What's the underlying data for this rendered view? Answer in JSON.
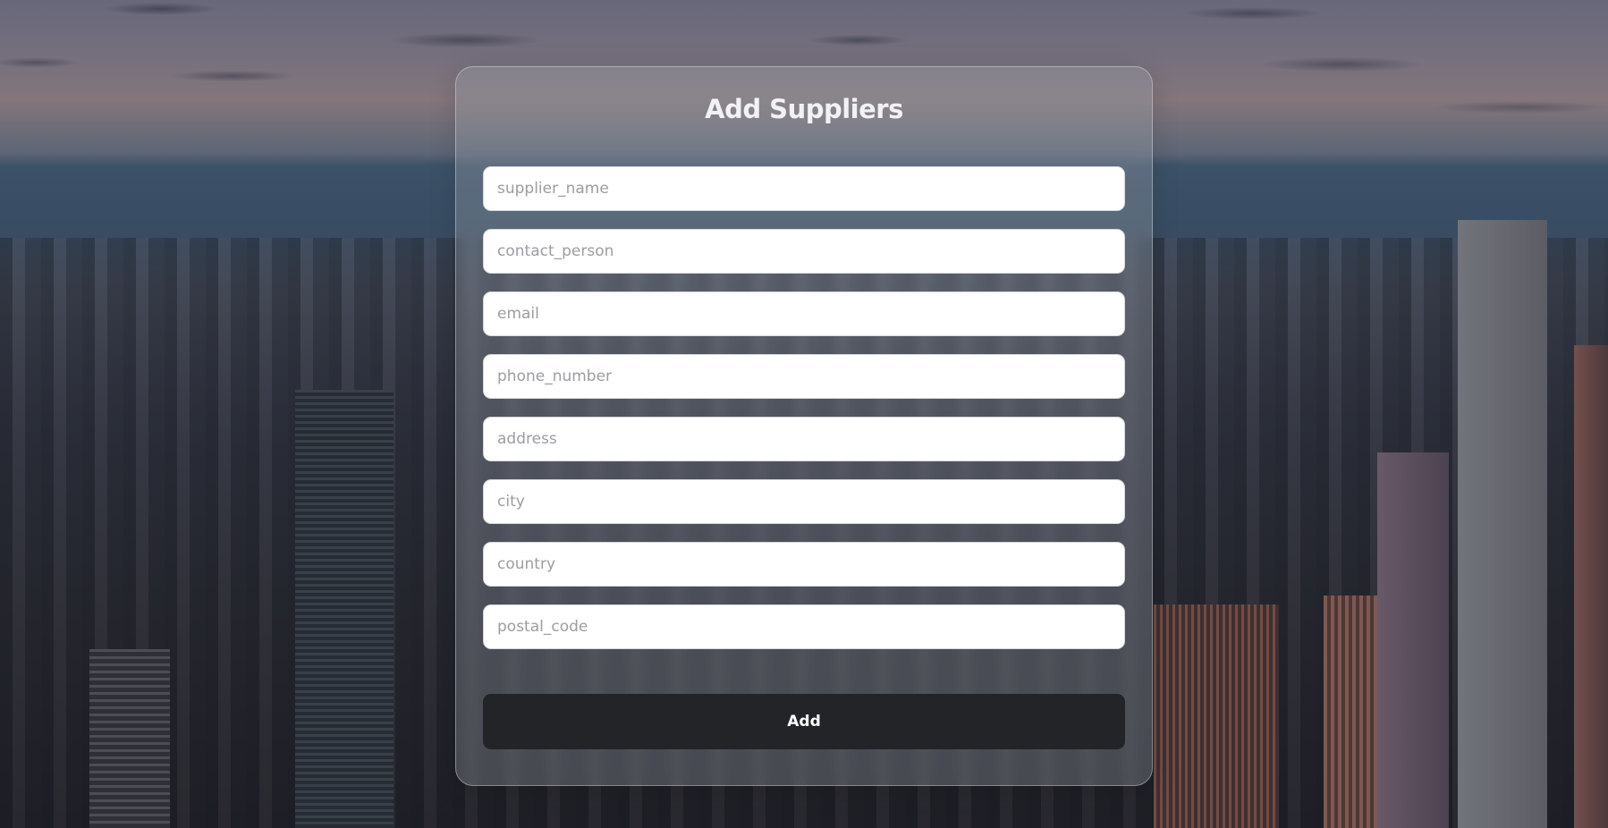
{
  "form": {
    "title": "Add Suppliers",
    "fields": [
      {
        "name": "supplier_name",
        "placeholder": "supplier_name",
        "value": ""
      },
      {
        "name": "contact_person",
        "placeholder": "contact_person",
        "value": ""
      },
      {
        "name": "email",
        "placeholder": "email",
        "value": ""
      },
      {
        "name": "phone_number",
        "placeholder": "phone_number",
        "value": ""
      },
      {
        "name": "address",
        "placeholder": "address",
        "value": ""
      },
      {
        "name": "city",
        "placeholder": "city",
        "value": ""
      },
      {
        "name": "country",
        "placeholder": "country",
        "value": ""
      },
      {
        "name": "postal_code",
        "placeholder": "postal_code",
        "value": ""
      }
    ],
    "submit_label": "Add"
  },
  "colors": {
    "button_bg": "#232428",
    "button_text": "#ffffff",
    "title_text": "#f2f2f4",
    "placeholder": "#9c9ca3"
  }
}
